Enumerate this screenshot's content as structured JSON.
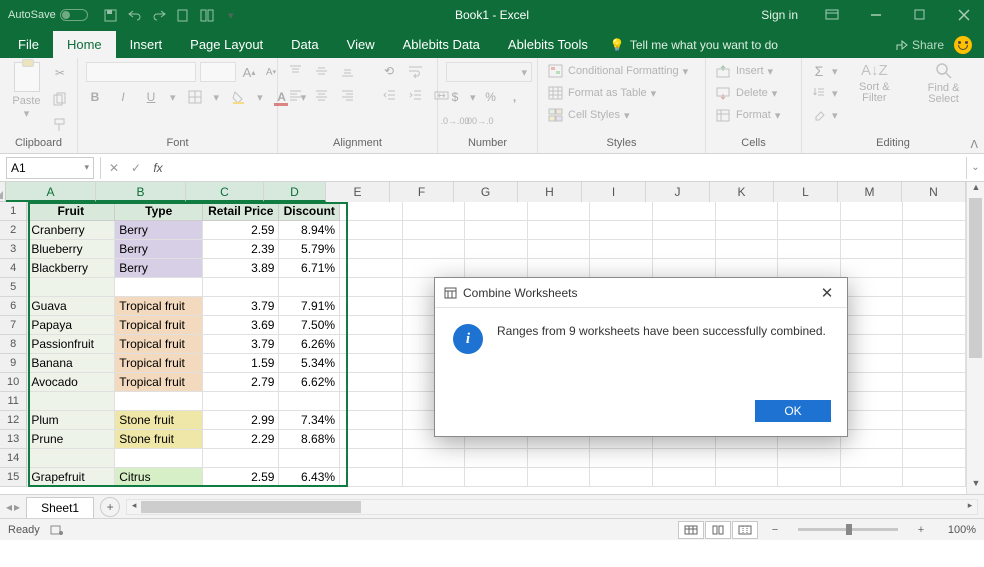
{
  "titlebar": {
    "autosave_label": "AutoSave",
    "autosave_state": "Off",
    "doc_title": "Book1 - Excel",
    "signin": "Sign in"
  },
  "tabs": {
    "file": "File",
    "home": "Home",
    "insert": "Insert",
    "page_layout": "Page Layout",
    "data": "Data",
    "view": "View",
    "ablebits_data": "Ablebits Data",
    "ablebits_tools": "Ablebits Tools",
    "tell_me": "Tell me what you want to do",
    "share": "Share"
  },
  "ribbon": {
    "clipboard": {
      "label": "Clipboard",
      "paste": "Paste"
    },
    "font": {
      "label": "Font",
      "bold": "B",
      "italic": "I",
      "underline": "U",
      "grow": "A",
      "shrink": "A"
    },
    "alignment": {
      "label": "Alignment"
    },
    "number": {
      "label": "Number",
      "currency": "$",
      "percent": "%",
      "comma": ",",
      "inc": ".0 .00",
      "dec": ".00 .0"
    },
    "styles": {
      "label": "Styles",
      "cond": "Conditional Formatting",
      "table": "Format as Table",
      "cell": "Cell Styles"
    },
    "cells": {
      "label": "Cells",
      "insert": "Insert",
      "delete": "Delete",
      "format": "Format"
    },
    "editing": {
      "label": "Editing",
      "sort": "Sort & Filter",
      "find": "Find & Select",
      "sum": "Σ"
    }
  },
  "formula": {
    "name_box": "A1",
    "fx": "fx"
  },
  "columns": [
    "A",
    "B",
    "C",
    "D",
    "E",
    "F",
    "G",
    "H",
    "I",
    "J",
    "K",
    "L",
    "M",
    "N"
  ],
  "headers": {
    "a": "Fruit",
    "b": "Type",
    "c": "Retail Price",
    "d": "Discount"
  },
  "data_rows": [
    {
      "r": 2,
      "a": "Cranberry",
      "b": "Berry",
      "c": "2.59",
      "d": "8.94%",
      "cls": "berry"
    },
    {
      "r": 3,
      "a": "Blueberry",
      "b": "Berry",
      "c": "2.39",
      "d": "5.79%",
      "cls": "berry"
    },
    {
      "r": 4,
      "a": "Blackberry",
      "b": "Berry",
      "c": "3.89",
      "d": "6.71%",
      "cls": "berry"
    },
    {
      "r": 5,
      "a": "",
      "b": "",
      "c": "",
      "d": "",
      "cls": ""
    },
    {
      "r": 6,
      "a": "Guava",
      "b": "Tropical fruit",
      "c": "3.79",
      "d": "7.91%",
      "cls": "trop"
    },
    {
      "r": 7,
      "a": "Papaya",
      "b": "Tropical fruit",
      "c": "3.69",
      "d": "7.50%",
      "cls": "trop"
    },
    {
      "r": 8,
      "a": "Passionfruit",
      "b": "Tropical fruit",
      "c": "3.79",
      "d": "6.26%",
      "cls": "trop"
    },
    {
      "r": 9,
      "a": "Banana",
      "b": "Tropical fruit",
      "c": "1.59",
      "d": "5.34%",
      "cls": "trop"
    },
    {
      "r": 10,
      "a": "Avocado",
      "b": "Tropical fruit",
      "c": "2.79",
      "d": "6.62%",
      "cls": "trop"
    },
    {
      "r": 11,
      "a": "",
      "b": "",
      "c": "",
      "d": "",
      "cls": ""
    },
    {
      "r": 12,
      "a": "Plum",
      "b": "Stone fruit",
      "c": "2.99",
      "d": "7.34%",
      "cls": "stone"
    },
    {
      "r": 13,
      "a": "Prune",
      "b": "Stone fruit",
      "c": "2.29",
      "d": "8.68%",
      "cls": "stone"
    },
    {
      "r": 14,
      "a": "",
      "b": "",
      "c": "",
      "d": "",
      "cls": ""
    },
    {
      "r": 15,
      "a": "Grapefruit",
      "b": "Citrus",
      "c": "2.59",
      "d": "6.43%",
      "cls": "citrus"
    }
  ],
  "sheet": {
    "name": "Sheet1"
  },
  "status": {
    "ready": "Ready",
    "zoom": "100%"
  },
  "dialog": {
    "title": "Combine Worksheets",
    "message": "Ranges from 9 worksheets have been successfully combined.",
    "ok": "OK"
  }
}
